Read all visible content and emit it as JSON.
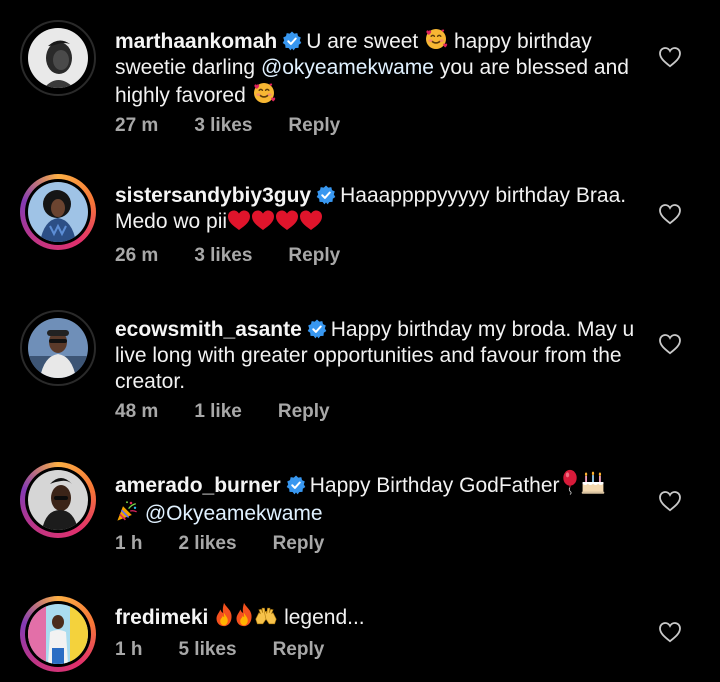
{
  "comments": [
    {
      "username": "marthaankomah",
      "verified": true,
      "text_1": "U are sweet",
      "text_2": "happy birthday sweetie darling",
      "mention": "@okyeamekwame",
      "text_3": "you are blessed and highly favored",
      "time": "27 m",
      "likes": "3 likes",
      "reply": "Reply",
      "story_ring": false
    },
    {
      "username": "sistersandybiy3guy",
      "verified": true,
      "text_1": "Haaappppyyyyy birthday Braa. Medo wo pii",
      "time": "26 m",
      "likes": "3 likes",
      "reply": "Reply",
      "story_ring": true
    },
    {
      "username": "ecowsmith_asante",
      "verified": true,
      "text_1": "Happy birthday my broda. May u live long with greater opportunities and favour from the creator.",
      "time": "48 m",
      "likes": "1 like",
      "reply": "Reply",
      "story_ring": false
    },
    {
      "username": "amerado_burner",
      "verified": true,
      "text_1": "Happy Birthday GodFather",
      "mention": "@Okyeamekwame",
      "time": "1 h",
      "likes": "2 likes",
      "reply": "Reply",
      "story_ring": true
    },
    {
      "username": "fredimeki",
      "verified": false,
      "text_1": "legend...",
      "time": "1 h",
      "likes": "5 likes",
      "reply": "Reply",
      "story_ring": true
    }
  ],
  "icons": {
    "verified": "verified-badge-icon",
    "like": "heart-outline-icon",
    "emoji_smile_hearts": "smiling-face-with-hearts-emoji",
    "emoji_heart": "red-heart-emoji",
    "emoji_balloon": "balloon-emoji",
    "emoji_cake": "birthday-cake-emoji",
    "emoji_party": "party-popper-emoji",
    "emoji_fire": "fire-emoji",
    "emoji_hands": "raising-hands-emoji"
  },
  "colors": {
    "background": "#000000",
    "text": "#f5f5f5",
    "meta": "#a8a8a8",
    "verified_blue": "#3897f0",
    "mention": "#e0f1ff"
  }
}
